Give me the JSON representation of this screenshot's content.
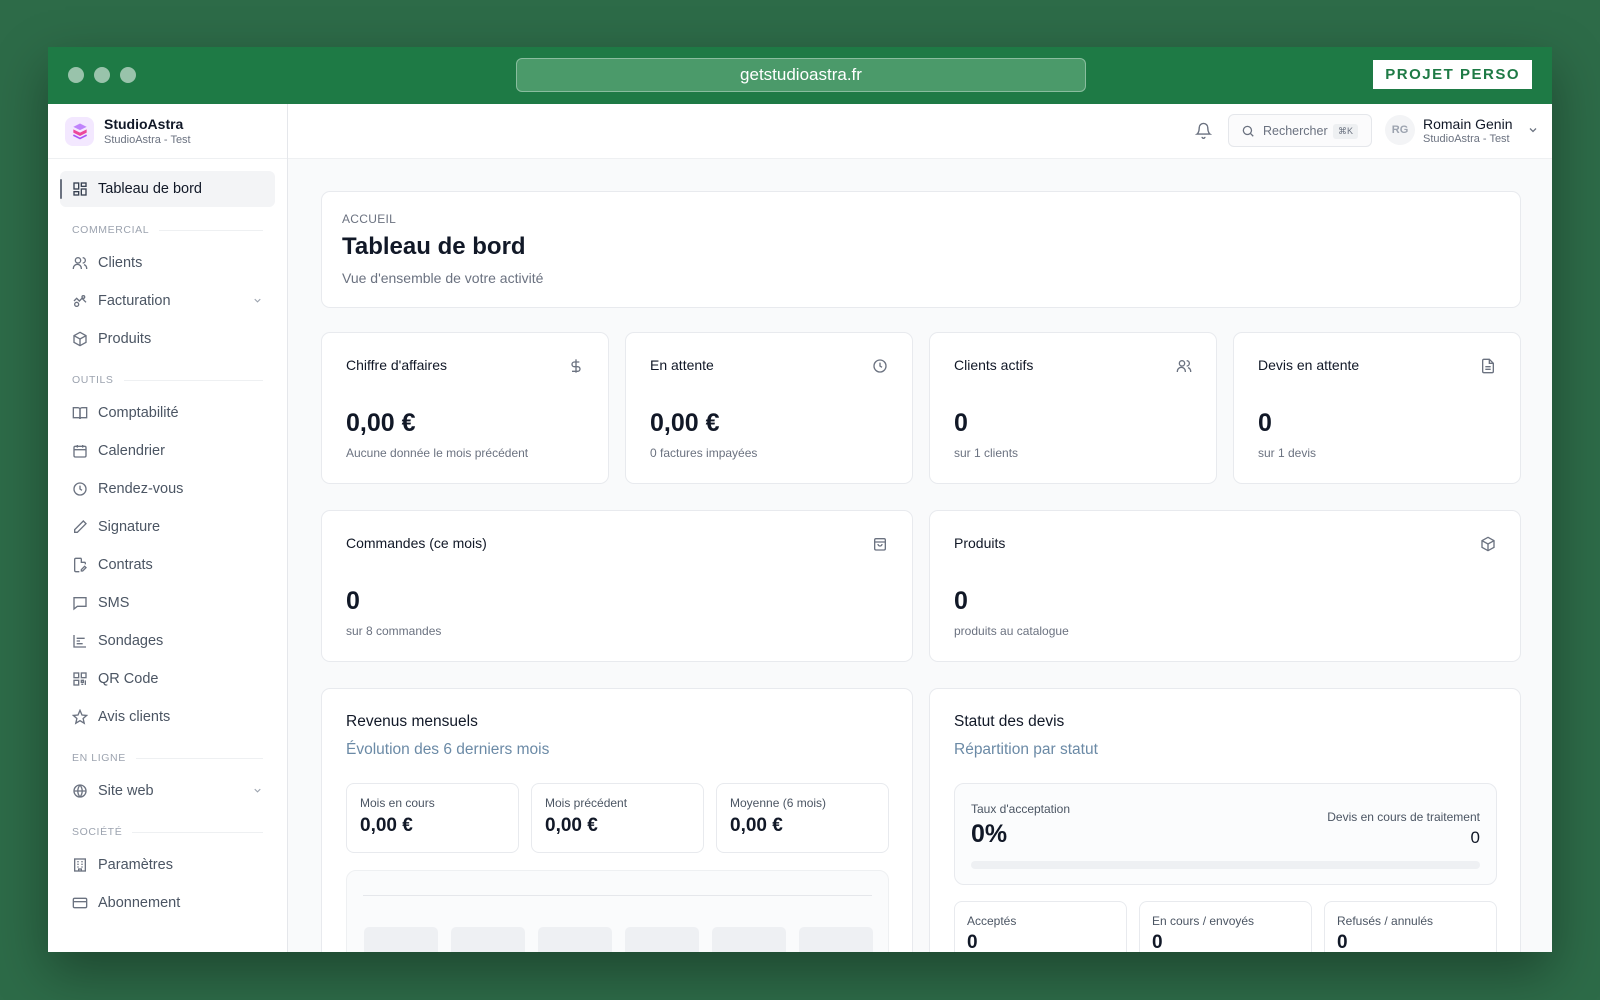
{
  "browser": {
    "url": "getstudioastra.fr",
    "badge": "PROJET PERSO"
  },
  "brand": {
    "name": "StudioAstra",
    "subtitle": "StudioAstra - Test"
  },
  "sidebar": {
    "active": {
      "label": "Tableau de bord",
      "icon": "dashboard-icon"
    },
    "sections": [
      {
        "title": "COMMERCIAL",
        "items": [
          {
            "label": "Clients",
            "icon": "users-icon"
          },
          {
            "label": "Facturation",
            "icon": "billing-icon",
            "has_submenu": true
          },
          {
            "label": "Produits",
            "icon": "box-icon"
          }
        ]
      },
      {
        "title": "OUTILS",
        "items": [
          {
            "label": "Comptabilité",
            "icon": "book-icon"
          },
          {
            "label": "Calendrier",
            "icon": "calendar-icon"
          },
          {
            "label": "Rendez-vous",
            "icon": "clock-icon"
          },
          {
            "label": "Signature",
            "icon": "pen-icon"
          },
          {
            "label": "Contrats",
            "icon": "contract-icon"
          },
          {
            "label": "SMS",
            "icon": "message-icon"
          },
          {
            "label": "Sondages",
            "icon": "chart-icon"
          },
          {
            "label": "QR Code",
            "icon": "qr-icon"
          },
          {
            "label": "Avis clients",
            "icon": "star-icon"
          }
        ]
      },
      {
        "title": "EN LIGNE",
        "items": [
          {
            "label": "Site web",
            "icon": "globe-icon",
            "has_submenu": true
          }
        ]
      },
      {
        "title": "SOCIÉTÉ",
        "items": [
          {
            "label": "Paramètres",
            "icon": "building-icon"
          },
          {
            "label": "Abonnement",
            "icon": "credit-card-icon"
          }
        ]
      }
    ]
  },
  "topbar": {
    "search_placeholder": "Rechercher",
    "search_shortcut": "⌘K",
    "user": {
      "initials": "RG",
      "name": "Romain Genin",
      "org": "StudioAstra - Test"
    }
  },
  "page": {
    "breadcrumb": "ACCUEIL",
    "title": "Tableau de bord",
    "subtitle": "Vue d'ensemble de votre activité"
  },
  "stats": [
    {
      "title": "Chiffre d'affaires",
      "value": "0,00 €",
      "desc": "Aucune donnée le mois précédent",
      "icon": "dollar-icon"
    },
    {
      "title": "En attente",
      "value": "0,00 €",
      "desc": "0 factures impayées",
      "icon": "clock-icon"
    },
    {
      "title": "Clients actifs",
      "value": "0",
      "desc": "sur 1 clients",
      "icon": "users-icon"
    },
    {
      "title": "Devis en attente",
      "value": "0",
      "desc": "sur 1 devis",
      "icon": "document-icon"
    }
  ],
  "stats2": [
    {
      "title": "Commandes (ce mois)",
      "value": "0",
      "desc": "sur 8 commandes",
      "icon": "shopping-bag-icon"
    },
    {
      "title": "Produits",
      "value": "0",
      "desc": "produits au catalogue",
      "icon": "box-icon"
    }
  ],
  "revenue": {
    "title": "Revenus mensuels",
    "subtitle": "Évolution des 6 derniers mois",
    "minis": [
      {
        "label": "Mois en cours",
        "value": "0,00 €"
      },
      {
        "label": "Mois précédent",
        "value": "0,00 €"
      },
      {
        "label": "Moyenne (6 mois)",
        "value": "0,00 €"
      }
    ]
  },
  "quotes": {
    "title": "Statut des devis",
    "subtitle": "Répartition par statut",
    "acceptance_label": "Taux d'acceptation",
    "acceptance_value": "0%",
    "acceptance_fraction": 0,
    "processing_label": "Devis en cours de traitement",
    "processing_value": "0",
    "breakdown": [
      {
        "label": "Acceptés",
        "value": "0"
      },
      {
        "label": "En cours / envoyés",
        "value": "0"
      },
      {
        "label": "Refusés / annulés",
        "value": "0"
      }
    ]
  }
}
